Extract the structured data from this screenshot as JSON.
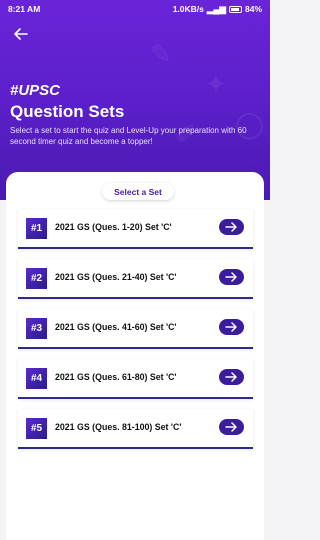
{
  "status_bar": {
    "time": "8:21 AM",
    "network_speed": "1.0KB/s",
    "battery": "84%"
  },
  "header": {
    "back_icon": "arrow-left-icon",
    "hashtag": "#UPSC",
    "title": "Question Sets",
    "description": "Select a set to start the quiz and Level-Up your preparation with 60 second timer quiz and become a topper!"
  },
  "select_label": "Select a Set",
  "sets": [
    {
      "number": "#1",
      "title": "2021 GS (Ques. 1-20) Set 'C'"
    },
    {
      "number": "#2",
      "title": "2021 GS (Ques. 21-40) Set 'C'"
    },
    {
      "number": "#3",
      "title": "2021 GS (Ques. 41-60) Set 'C'"
    },
    {
      "number": "#4",
      "title": "2021 GS (Ques. 61-80) Set 'C'"
    },
    {
      "number": "#5",
      "title": "2021 GS (Ques. 81-100) Set 'C'"
    }
  ],
  "colors": {
    "header_gradient_top": "#6a24d8",
    "header_gradient_bottom": "#4a1ab0",
    "accent": "#3a1c9c",
    "row_underline": "#2b2a8e"
  }
}
